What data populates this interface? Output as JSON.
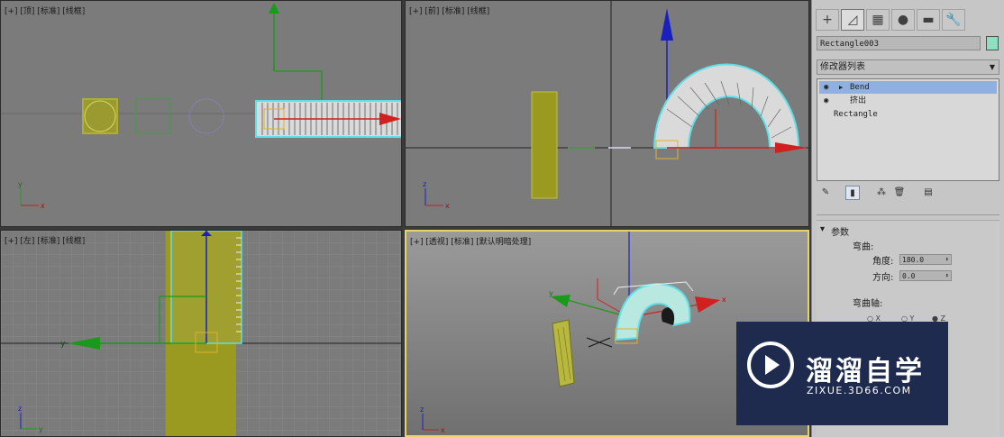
{
  "viewports": {
    "top": {
      "label": "[+] [顶] [标准] [线框]"
    },
    "front": {
      "label": "[+] [前] [标准] [线框]"
    },
    "left": {
      "label": "[+] [左] [标准] [线框]"
    },
    "persp": {
      "label": "[+] [透视] [标准] [默认明暗处理]"
    }
  },
  "axis": {
    "x": "x",
    "y": "y",
    "z": "z"
  },
  "panel": {
    "tabs": [
      {
        "icon": "create-icon",
        "glyph": "+"
      },
      {
        "icon": "modify-icon",
        "glyph": "◿"
      },
      {
        "icon": "hierarchy-icon",
        "glyph": "▦"
      },
      {
        "icon": "motion-icon",
        "glyph": "●"
      },
      {
        "icon": "display-icon",
        "glyph": "▬"
      },
      {
        "icon": "utilities-icon",
        "glyph": "🔧"
      }
    ],
    "object_name": "Rectangle003",
    "object_color": "#8fe0c0",
    "modifier_list": "修改器列表",
    "stack": [
      {
        "label": "Bend",
        "selected": true
      },
      {
        "label": "挤出",
        "selected": false
      },
      {
        "label": "Rectangle",
        "selected": false
      }
    ],
    "params": {
      "title": "参数",
      "bend_label": "弯曲:",
      "angle_label": "角度:",
      "angle_value": "180.0",
      "direction_label": "方向:",
      "direction_value": "0.0",
      "bend_axis_label": "弯曲轴:",
      "axis_x": "X",
      "axis_y": "Y",
      "axis_z": "Z",
      "selected_axis": "Z"
    }
  },
  "watermark": {
    "cn": "溜溜自学",
    "url": "ZIXUE.3D66.COM"
  },
  "colors": {
    "accent_blue": "#8fb0e0",
    "viewport_gray": "#7b7b7b",
    "active_border": "#e8d36a"
  }
}
